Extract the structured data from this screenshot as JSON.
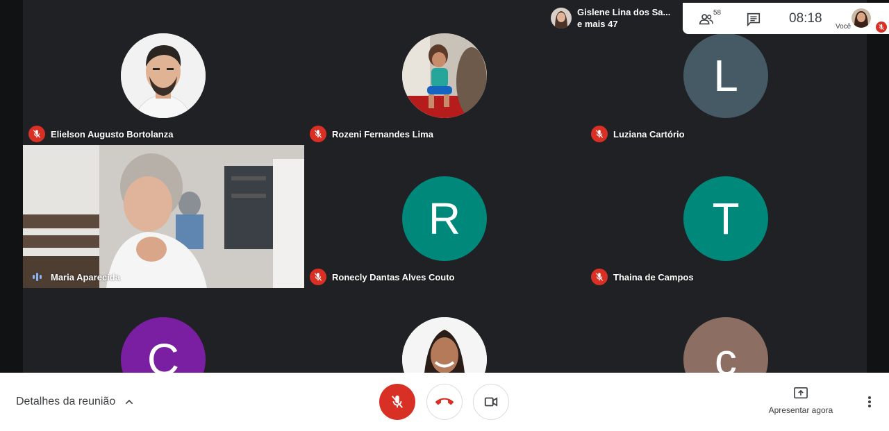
{
  "colors": {
    "mic_off": "#d93025",
    "speaking": "#8ab4f8",
    "tile_bg": "#202124"
  },
  "participants": [
    {
      "name": "Elielson Augusto Bortolanza",
      "avatar": "photo-man",
      "muted": true
    },
    {
      "name": "Rozeni Fernandes Lima",
      "avatar": "photo-child",
      "muted": true
    },
    {
      "name": "Luziana Cartório",
      "avatar": "L",
      "avatar_color": "#455a64",
      "muted": true
    },
    {
      "name": "Maria Aparecida",
      "avatar": "video",
      "muted": false,
      "speaking": true
    },
    {
      "name": "Ronecly Dantas Alves Couto",
      "avatar": "R",
      "avatar_color": "#00897b",
      "muted": true
    },
    {
      "name": "Thaina de Campos",
      "avatar": "T",
      "avatar_color": "#00897b",
      "muted": true
    },
    {
      "name": "",
      "avatar": "C",
      "avatar_color": "#7b1fa2"
    },
    {
      "name": "",
      "avatar": "photo-woman"
    },
    {
      "name": "",
      "avatar": "c",
      "avatar_color": "#8d6e63"
    }
  ],
  "presenter_chip": {
    "line1": "Gislene Lina dos Sa...",
    "line2": "e mais 47"
  },
  "topbar": {
    "people_count": "58",
    "time": "08:18",
    "you_label": "Você"
  },
  "bottombar": {
    "details_label": "Detalhes da reunião",
    "present_label": "Apresentar agora"
  },
  "icons": [
    "people-icon",
    "chat-icon",
    "mic-off-icon",
    "hangup-icon",
    "camera-icon",
    "present-icon",
    "more-icon",
    "chevron-up-icon"
  ]
}
